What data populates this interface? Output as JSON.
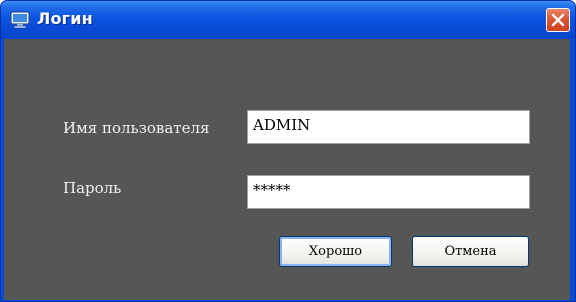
{
  "window": {
    "title": "Логин",
    "icon": "monitor-icon",
    "close_icon": "close-icon"
  },
  "form": {
    "username_label": "Имя пользователя",
    "username_value": "ADMIN",
    "password_label": "Пароль",
    "password_value": "*****"
  },
  "buttons": {
    "ok_label": "Хорошо",
    "cancel_label": "Отмена"
  },
  "colors": {
    "titlebar": "#0a4bd6",
    "client_background": "#565656",
    "close_button": "#d9532f"
  }
}
